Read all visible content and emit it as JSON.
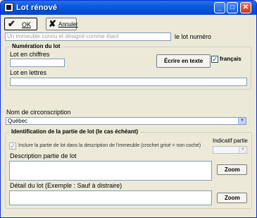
{
  "window": {
    "title": "Lot rénové"
  },
  "toolbar": {
    "ok_label": "OK",
    "ok_icon": "checkmark-icon",
    "cancel_label": "Annuler",
    "cancel_icon": "x-icon"
  },
  "lot_header": {
    "placeholder": "Un immeuble connu et désigné comme étant",
    "suffix_label": "le lot numéro"
  },
  "numeration": {
    "group_title": "Numération du lot",
    "lot_en_chiffres_label": "Lot en chiffres",
    "lot_en_chiffres_value": "",
    "ecrire_button": "Écrire en texte",
    "francais_label": "français",
    "francais_checked": true,
    "lot_en_lettres_label": "Lot en lettres",
    "lot_en_lettres_value": ""
  },
  "circonscription": {
    "label": "Nom de circonscription",
    "value": "Québec"
  },
  "identification": {
    "group_title": "Identification de la partie de lot (le cas échéant)",
    "include_label": "Inclure la partie de lot dans la description de l'immeuble (crochet grisé = non coché)",
    "include_checked": true,
    "indicatif_label": "Indicatif partie",
    "indicatif_value": "",
    "description_label": "Description partie de lot",
    "description_value": "",
    "zoom1_label": "Zoom",
    "detail_label": "Détail du lot (Exemple : Sauf à distraire)",
    "detail_value": "",
    "zoom2_label": "Zoom"
  }
}
